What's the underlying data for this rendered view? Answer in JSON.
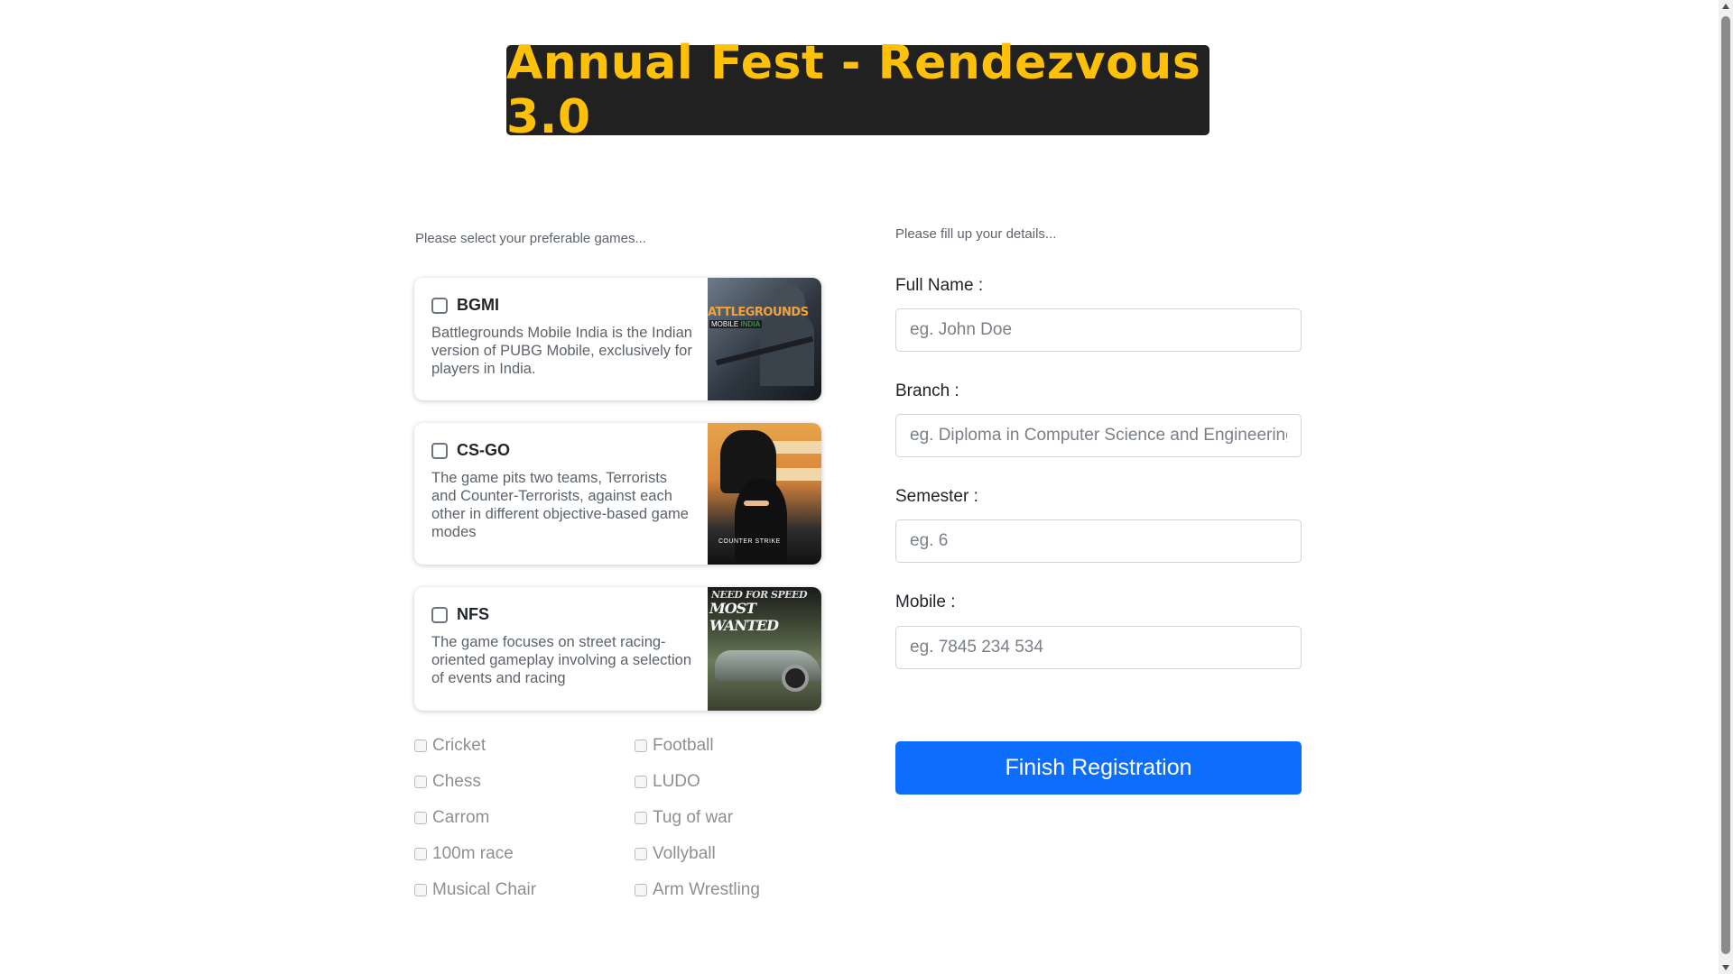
{
  "header": {
    "title": "Annual Fest - Rendezvous 3.0"
  },
  "games_hint": "Please select your preferable games...",
  "details_hint": "Please fill up your details...",
  "featured_games": [
    {
      "name": "BGMI",
      "description": "Battlegrounds Mobile India is the Indian version of PUBG Mobile, exclusively for players in India.",
      "image_text": "ATTLEGROUNDS",
      "image_subtext": "MOBILE",
      "image_subtext2": "INDIA",
      "checked": false
    },
    {
      "name": "CS-GO",
      "description": "The game pits two teams, Terrorists and Counter-Terrorists, against each other in different objective-based game modes",
      "image_text": "COUNTER STRIKE",
      "checked": false
    },
    {
      "name": "NFS",
      "description": "The game focuses on street racing-oriented gameplay involving a selection of events and racing",
      "image_text": "NEED FOR SPEED",
      "image_subtext": "MOST WANTED",
      "checked": false
    }
  ],
  "other_games": [
    "Cricket",
    "Football",
    "Chess",
    "LUDO",
    "Carrom",
    "Tug of war",
    "100m race",
    "Vollyball",
    "Musical Chair",
    "Arm Wrestling"
  ],
  "form": {
    "full_name": {
      "label": "Full Name :",
      "placeholder": "eg. John Doe"
    },
    "branch": {
      "label": "Branch :",
      "placeholder": "eg. Diploma in Computer Science and Engineering"
    },
    "semester": {
      "label": "Semester :",
      "placeholder": "eg. 6"
    },
    "mobile": {
      "label": "Mobile :",
      "placeholder": "eg. 7845 234 534"
    },
    "submit_label": "Finish Registration"
  },
  "colors": {
    "banner_bg": "#212121",
    "banner_text": "#ffc107",
    "primary": "#0d6efd"
  }
}
